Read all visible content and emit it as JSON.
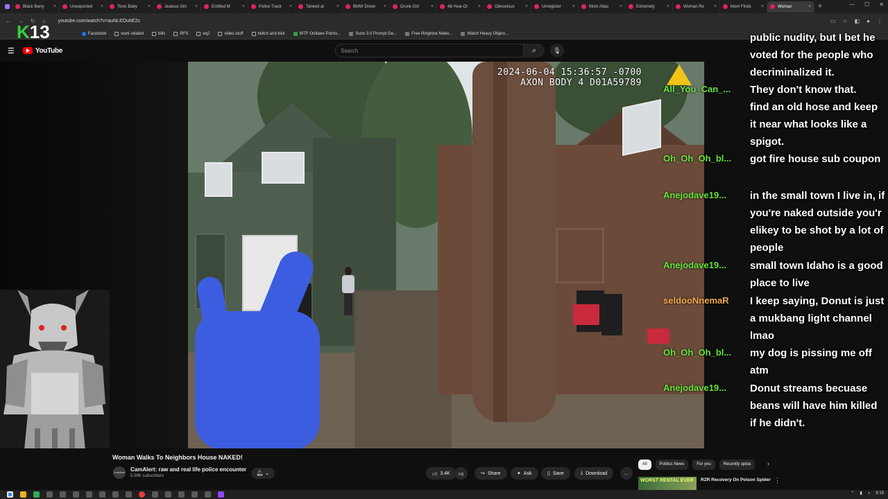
{
  "browser": {
    "tabs": [
      {
        "label": "Black Barry",
        "active": false
      },
      {
        "label": "Unexpected",
        "active": false
      },
      {
        "label": "Toxic Baby",
        "active": false
      },
      {
        "label": "Jealous Girl",
        "active": false
      },
      {
        "label": "Entitled M",
        "active": false
      },
      {
        "label": "Police Track",
        "active": false
      },
      {
        "label": "Tanked at",
        "active": false
      },
      {
        "label": "BMW Driver",
        "active": false
      },
      {
        "label": "Drunk Girl",
        "active": false
      },
      {
        "label": "48-Year-Ol",
        "active": false
      },
      {
        "label": "Obnoxious",
        "active": false
      },
      {
        "label": "Unregister",
        "active": false
      },
      {
        "label": "Mom Attac",
        "active": false
      },
      {
        "label": "Extremely",
        "active": false
      },
      {
        "label": "Woman Re",
        "active": false
      },
      {
        "label": "Mom Finds",
        "active": false
      },
      {
        "label": "Woman",
        "active": true
      }
    ],
    "new_tab": "+",
    "url": "youtube.com/watch?v=auNLEOu6E2c",
    "bookmarks": [
      {
        "label": "Facebook",
        "icon": "facebook-icon"
      },
      {
        "label": "work related",
        "icon": "folder-icon"
      },
      {
        "label": "bills",
        "icon": "folder-icon"
      },
      {
        "label": "RFS",
        "icon": "folder-icon"
      },
      {
        "label": "eq2",
        "icon": "folder-icon"
      },
      {
        "label": "video stuff",
        "icon": "folder-icon"
      },
      {
        "label": "twitch and kick",
        "icon": "folder-icon"
      },
      {
        "label": "WTF Outlaws Points...",
        "icon": "green-plus-icon"
      },
      {
        "label": "Suno 3.0 Prompt Ge...",
        "icon": "suno-icon"
      },
      {
        "label": "Free Ringtone Make...",
        "icon": "page-icon"
      },
      {
        "label": "Watch Heavy Object...",
        "icon": "globe-icon"
      }
    ]
  },
  "overlay": {
    "logo_k": "K",
    "logo_num": "13"
  },
  "youtube": {
    "logo_text": "YouTube",
    "search_placeholder": "Search"
  },
  "video": {
    "timestamp": "2024-06-04 15:36:57 -0700",
    "device": "AXON BODY 4 D01A59789",
    "title": "Woman Walks To Neighbors House NAKED!",
    "channel_name": "CamAlert: raw and real life police encounter",
    "channel_avatar": "CamAlert",
    "subscribers": "5.59K subscribers",
    "likes": "3.4K",
    "share_label": "Share",
    "ask_label": "Ask",
    "save_label": "Save",
    "download_label": "Download",
    "more_label": "..."
  },
  "chat": [
    {
      "user": "",
      "message": "public nudity, but I bet he voted for the people who decriminalized it.",
      "color": "#64e43a"
    },
    {
      "user": "All_You_Can_...",
      "message": "They don't know that.",
      "color": "#64e43a"
    },
    {
      "user": "",
      "message": "find an old hose and keep it near what looks like a spigot.",
      "color": "#64e43a"
    },
    {
      "user": "Oh_Oh_Oh_bl...",
      "message": "got fire house sub coupon",
      "color": "#64e43a"
    },
    {
      "user": "Anejodave19...",
      "message": "in the small town I live in, if you're naked outside you'r elikey to be shot by a lot of people",
      "color": "#64e43a"
    },
    {
      "user": "Anejodave19...",
      "message": "small town Idaho is a good place to live",
      "color": "#64e43a"
    },
    {
      "user": "seldooNnemaR",
      "message": "I keep saying, Donut is just a mukbang light channel lmao",
      "color": "#f0a94a"
    },
    {
      "user": "Oh_Oh_Oh_bl...",
      "message": "my dog is pissing me off atm",
      "color": "#64e43a"
    },
    {
      "user": "Anejodave19...",
      "message": "Donut streams becuase beans will have him killed if he didn't.",
      "color": "#64e43a"
    }
  ],
  "chips": [
    {
      "label": "All",
      "active": true
    },
    {
      "label": "Politics News",
      "active": false
    },
    {
      "label": "For you",
      "active": false
    },
    {
      "label": "Recently uploa",
      "active": false
    }
  ],
  "recommendation": {
    "thumb_text": "WORST RENTAL EVER",
    "title": "RZR Recovery On Poison Spider"
  },
  "taskbar": {
    "clock": "9:19"
  }
}
